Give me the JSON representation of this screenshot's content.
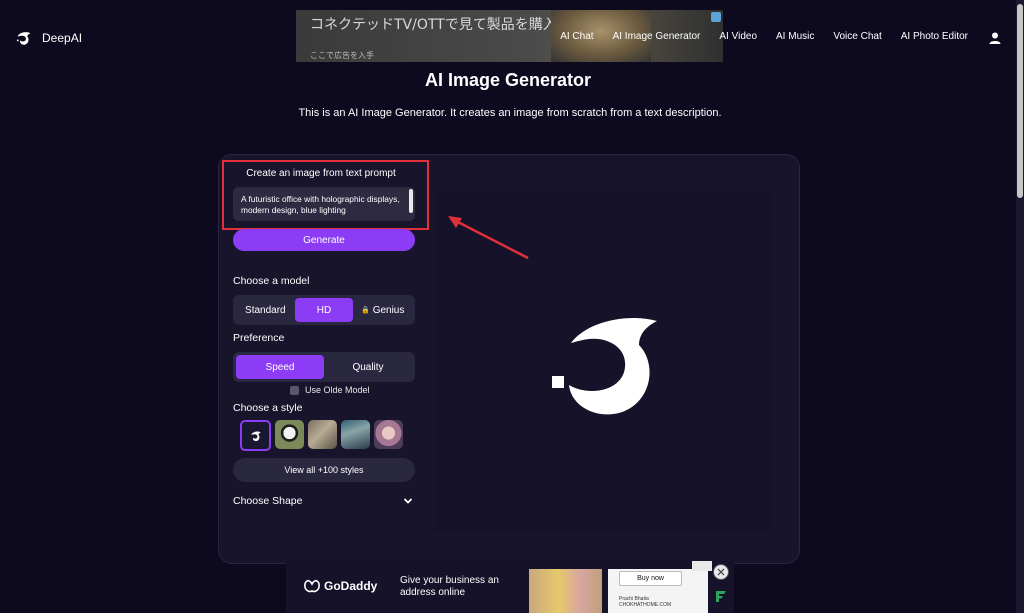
{
  "top_ad": {
    "headline": "コネクテッドTV/OTTで見て製品を購入",
    "fine_print": "ここで広告を入手"
  },
  "header": {
    "brand": "DeepAI",
    "nav": [
      "AI Chat",
      "AI Image Generator",
      "AI Video",
      "AI Music",
      "Voice Chat",
      "AI Photo Editor"
    ]
  },
  "main": {
    "title": "AI Image Generator",
    "description": "This is an AI Image Generator. It creates an image from scratch from a text description."
  },
  "prompt": {
    "label": "Create an image from text prompt",
    "value": "A futuristic office with holographic displays, modern design, blue lighting"
  },
  "generate_label": "Generate",
  "model": {
    "label": "Choose a model",
    "options": [
      "Standard",
      "HD",
      "Genius"
    ],
    "selected": "HD"
  },
  "preference": {
    "label": "Preference",
    "options": [
      "Speed",
      "Quality"
    ],
    "selected": "Speed"
  },
  "olde_model_label": "Use Olde Model",
  "style": {
    "label": "Choose a style",
    "view_all_label": "View all +100 styles"
  },
  "shape_label": "Choose Shape",
  "bottom_ad": {
    "brand": "GoDaddy",
    "tagline": "Give your business an address online",
    "cta": "Buy now",
    "credit_name": "Prachi Bhatia",
    "credit_site": "CHOKHATHOME.COM"
  },
  "colors": {
    "accent": "#8c3cf5",
    "highlight": "#e0303a",
    "background": "#0d0a1f"
  }
}
